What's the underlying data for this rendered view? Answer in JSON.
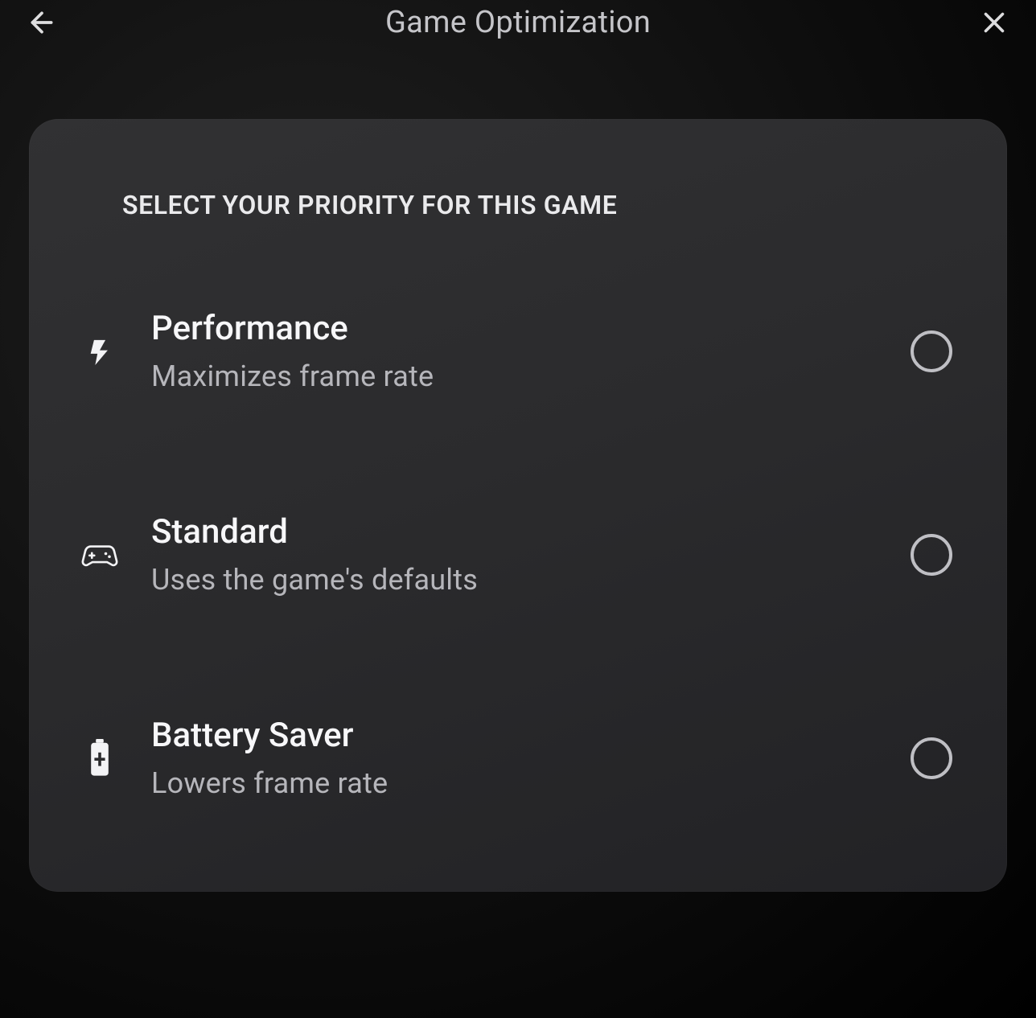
{
  "header": {
    "title": "Game Optimization"
  },
  "card": {
    "section_title": "SELECT YOUR PRIORITY FOR THIS GAME",
    "options": [
      {
        "title": "Performance",
        "subtitle": "Maximizes frame rate"
      },
      {
        "title": "Standard",
        "subtitle": "Uses the game's defaults"
      },
      {
        "title": "Battery Saver",
        "subtitle": "Lowers frame rate"
      }
    ]
  }
}
